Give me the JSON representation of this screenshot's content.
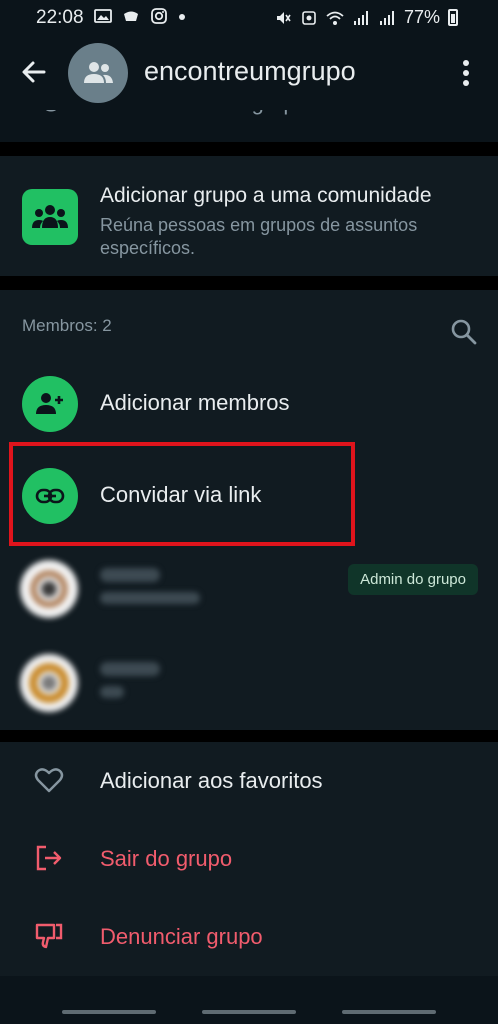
{
  "status_bar": {
    "time": "22:08",
    "battery": "77%",
    "left_icons": [
      "gallery-icon",
      "app-icon",
      "instagram-icon",
      "dot-icon"
    ],
    "right_icons": [
      "mute-icon",
      "recycle-icon",
      "wifi-icon",
      "signal-icon",
      "signal-icon",
      "battery-icon"
    ]
  },
  "app_bar": {
    "title": "encontreumgrupo",
    "back_icon": "arrow-left-icon",
    "menu_icon": "kebab-icon"
  },
  "partial_row": {
    "label": "Permissões do grupo"
  },
  "community": {
    "title": "Adicionar grupo a uma comunidade",
    "subtitle": "Reúna pessoas em grupos de assuntos específicos.",
    "icon": "community-icon",
    "color": "#21c063"
  },
  "members": {
    "label": "Membros: 2",
    "add_label": "Adicionar membros",
    "invite_label": "Convidar via link",
    "admin_badge": "Admin do grupo"
  },
  "actions": {
    "favorite_label": "Adicionar aos favoritos",
    "leave_label": "Sair do grupo",
    "report_label": "Denunciar grupo",
    "danger_color": "#f15c6d"
  },
  "highlight_color": "#e0141c"
}
